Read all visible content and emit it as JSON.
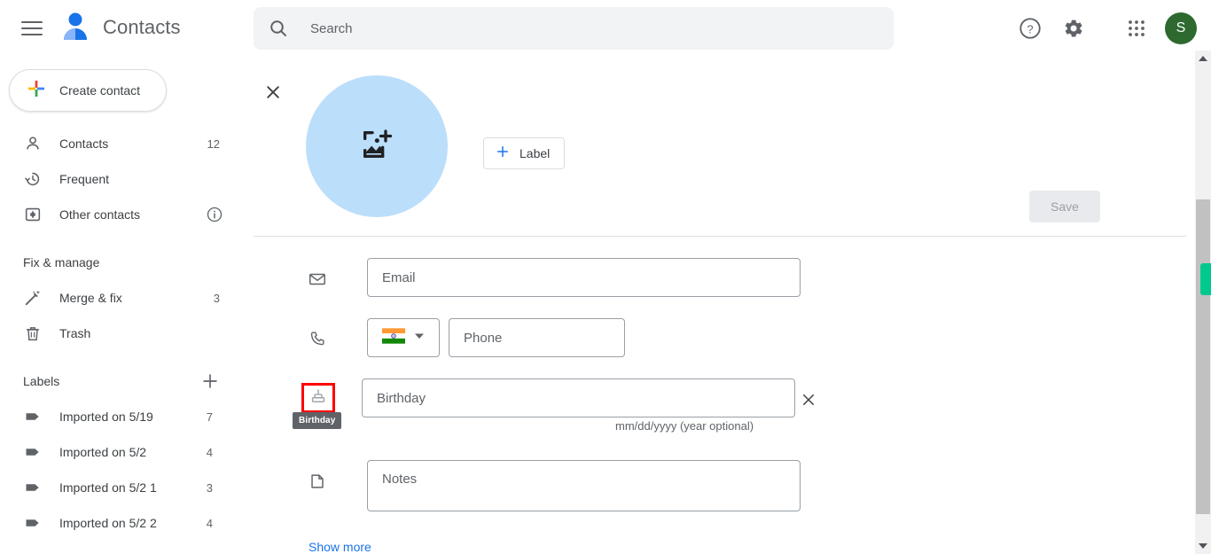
{
  "app": {
    "title": "Contacts",
    "brand_icon": "contacts-person-icon",
    "menu_icon": "hamburger-menu-icon"
  },
  "search": {
    "placeholder": "Search",
    "value": "",
    "icon": "search-icon"
  },
  "header_actions": [
    {
      "name": "help-icon",
      "label": "Help"
    },
    {
      "name": "settings-icon",
      "label": "Settings"
    },
    {
      "name": "google-apps-icon",
      "label": "Google apps"
    }
  ],
  "avatar": {
    "initial": "S",
    "color": "#2e6930"
  },
  "sidebar": {
    "create_button": {
      "label": "Create contact",
      "icon": "plus-multicolor-icon"
    },
    "items": [
      {
        "label": "Contacts",
        "count": "12",
        "icon": "person-outline-icon",
        "info": false
      },
      {
        "label": "Frequent",
        "count": "",
        "icon": "history-clock-icon",
        "info": false
      },
      {
        "label": "Other contacts",
        "count": "",
        "icon": "person-add-box-icon",
        "info": true
      }
    ],
    "fix_manage": {
      "heading": "Fix & manage",
      "items": [
        {
          "label": "Merge & fix",
          "count": "3",
          "icon": "magic-wand-icon"
        },
        {
          "label": "Trash",
          "count": "",
          "icon": "trash-icon"
        }
      ]
    },
    "labels": {
      "heading": "Labels",
      "add_icon": "plus-icon",
      "items": [
        {
          "label": "Imported on 5/19",
          "count": "7",
          "icon": "label-tag-icon"
        },
        {
          "label": "Imported on 5/2",
          "count": "4",
          "icon": "label-tag-icon"
        },
        {
          "label": "Imported on 5/2 1",
          "count": "3",
          "icon": "label-tag-icon"
        },
        {
          "label": "Imported on 5/2 2",
          "count": "4",
          "icon": "label-tag-icon"
        }
      ]
    }
  },
  "editor": {
    "close_icon": "close-x-icon",
    "photo": {
      "icon": "add-photo-icon",
      "bg_color": "#bbdefb"
    },
    "label_button": {
      "label": "Label",
      "icon": "plus-icon"
    },
    "save_button": {
      "label": "Save",
      "disabled": true
    },
    "fields": {
      "email": {
        "placeholder": "Email",
        "value": "",
        "icon": "envelope-icon"
      },
      "phone": {
        "placeholder": "Phone",
        "value": "",
        "icon": "phone-icon",
        "country": {
          "flag": "india-flag",
          "dropdown_icon": "caret-down-icon"
        }
      },
      "birthday": {
        "placeholder": "Birthday",
        "value": "",
        "icon": "birthday-cake-icon",
        "hint": "mm/dd/yyyy (year optional)",
        "tooltip": "Birthday",
        "clear_icon": "close-x-icon",
        "highlight_color": "#ff0000"
      },
      "notes": {
        "placeholder": "Notes",
        "value": "",
        "icon": "note-page-icon"
      }
    },
    "show_more": "Show more"
  },
  "scrollbar": {
    "up_icon": "scroll-up-arrow-icon",
    "down_icon": "scroll-down-arrow-icon",
    "marker_color": "#00c98d"
  }
}
